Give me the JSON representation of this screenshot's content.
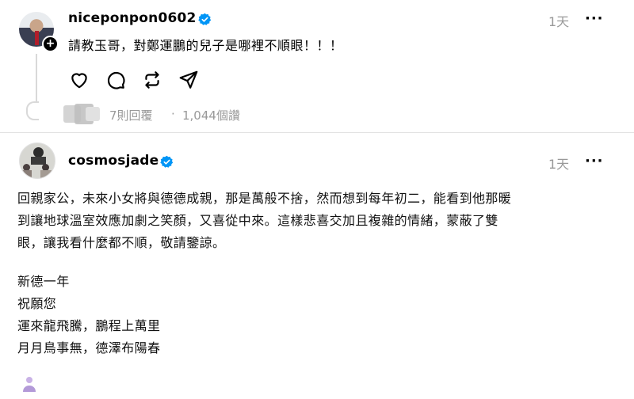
{
  "post1": {
    "username": "niceponpon0602",
    "time": "1天",
    "more": "···",
    "text": "請教玉哥，對鄭運鵬的兒子是哪裡不順眼！！！",
    "follow_badge": "+",
    "stats": {
      "replies": "7則回覆",
      "separator": "·",
      "views": "1,044個讚"
    },
    "actions": [
      "heart-icon",
      "comment-icon",
      "repost-icon",
      "share-icon"
    ]
  },
  "post2": {
    "username": "cosmosjade",
    "time": "1天",
    "more": "···",
    "paragraph_lines": [
      "回親家公，未來小女將與德德成親，那是萬般不捨，然而想到每年初二，能看到他那暖",
      "到讓地球溫室效應加劇之笑顏，又喜從中來。這樣悲喜交加且複雜的情緒，蒙蔽了雙",
      "眼，讓我看什麼都不順，敬請鑒諒。"
    ],
    "poem_lines": [
      "新德一年",
      "祝願您",
      "運來龍飛騰，鵬程上萬里",
      "月月鳥事無，德澤布陽春"
    ]
  },
  "colors": {
    "verified": "#0095f6",
    "secondary_text": "#999999",
    "divider": "#e2e2e2"
  }
}
